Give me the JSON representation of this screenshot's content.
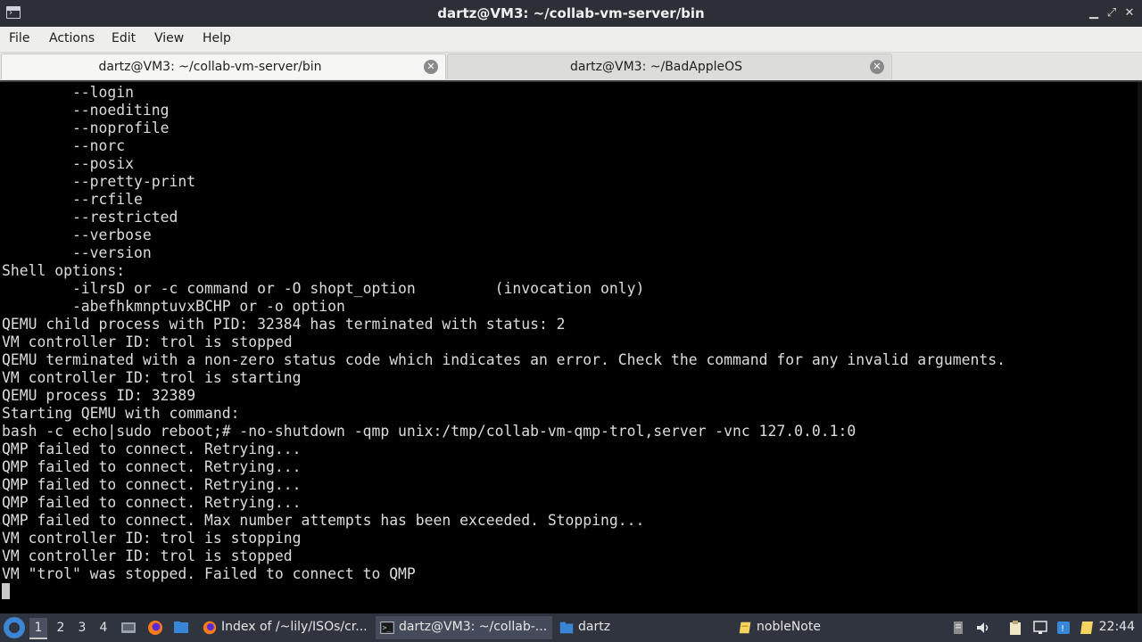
{
  "window": {
    "title": "dartz@VM3: ~/collab-vm-server/bin"
  },
  "menu": [
    "File",
    "Actions",
    "Edit",
    "View",
    "Help"
  ],
  "tabs": [
    {
      "label": "dartz@VM3: ~/collab-vm-server/bin",
      "active": true
    },
    {
      "label": "dartz@VM3: ~/BadAppleOS",
      "active": false
    }
  ],
  "terminal": {
    "lines": [
      "        --login",
      "        --noediting",
      "        --noprofile",
      "        --norc",
      "        --posix",
      "        --pretty-print",
      "        --rcfile",
      "        --restricted",
      "        --verbose",
      "        --version",
      "Shell options:",
      "        -ilrsD or -c command or -O shopt_option         (invocation only)",
      "        -abefhkmnptuvxBCHP or -o option",
      "QEMU child process with PID: 32384 has terminated with status: 2",
      "VM controller ID: trol is stopped",
      "QEMU terminated with a non-zero status code which indicates an error. Check the command for any invalid arguments.",
      "VM controller ID: trol is starting",
      "QEMU process ID: 32389",
      "Starting QEMU with command:",
      "bash -c echo|sudo reboot;# -no-shutdown -qmp unix:/tmp/collab-vm-qmp-trol,server -vnc 127.0.0.1:0",
      "QMP failed to connect. Retrying...",
      "QMP failed to connect. Retrying...",
      "QMP failed to connect. Retrying...",
      "QMP failed to connect. Retrying...",
      "QMP failed to connect. Max number attempts has been exceeded. Stopping...",
      "VM controller ID: trol is stopping",
      "VM controller ID: trol is stopped",
      "VM \"trol\" was stopped. Failed to connect to QMP"
    ]
  },
  "taskbar": {
    "workspaces": [
      "1",
      "2",
      "3",
      "4"
    ],
    "active_workspace": "1",
    "tasks": [
      {
        "label": "Index of /~lily/ISOs/cr...",
        "icon": "firefox-icon"
      },
      {
        "label": "dartz@VM3: ~/collab-...",
        "icon": "terminal-icon"
      },
      {
        "label": "dartz",
        "icon": "folder-icon"
      },
      {
        "label": "nobleNote",
        "icon": "note-icon"
      }
    ],
    "clock": "22:44"
  },
  "colors": {
    "terminal_bg": "#000000",
    "terminal_fg": "#dcdcdc",
    "taskbar_bg": "#2f343f",
    "titlebar_bg": "#2c2f36"
  }
}
